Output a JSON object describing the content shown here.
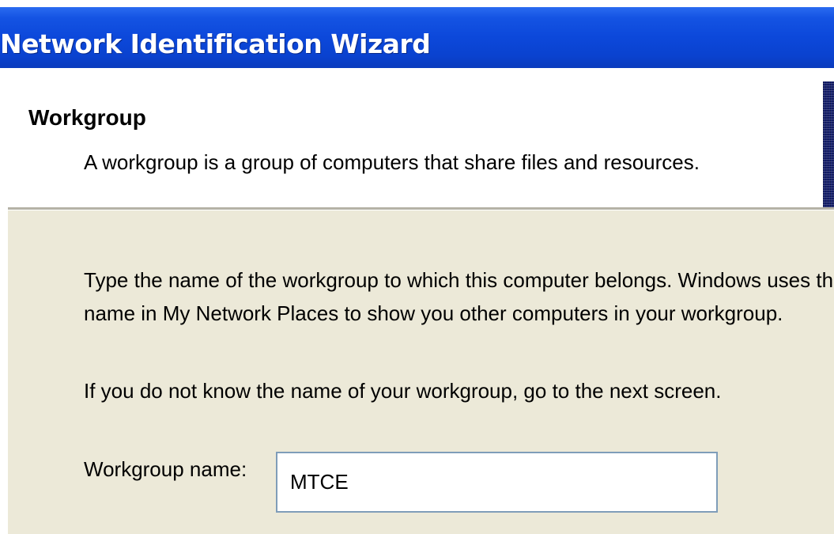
{
  "window": {
    "title": "Network Identification Wizard"
  },
  "header": {
    "title": "Workgroup",
    "subtitle": "A workgroup is a group of computers that share files and resources."
  },
  "body": {
    "instructions_line1": "Type the name of the workgroup to which this computer belongs. Windows uses this",
    "instructions_line2": "name in My Network Places to show you other computers in your workgroup.",
    "hint": "If you do not know the name of your workgroup, go to the next screen.",
    "workgroup_label": "Workgroup name:",
    "workgroup_value": "MTCE"
  },
  "colors": {
    "title_bar": "#0c48da",
    "panel_background": "#ece9d8",
    "field_border": "#7f9db9"
  }
}
